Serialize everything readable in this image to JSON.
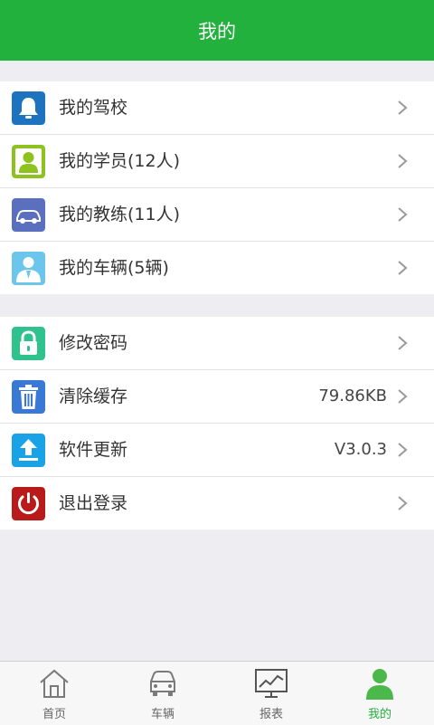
{
  "header": {
    "title": "我的"
  },
  "groups": [
    {
      "items": [
        {
          "label": "我的驾校",
          "value": "",
          "icon": "bell-icon",
          "color": "#1e73be"
        },
        {
          "label": "我的学员(12人)",
          "value": "",
          "icon": "student-icon",
          "color": "#8dc21f"
        },
        {
          "label": "我的教练(11人)",
          "value": "",
          "icon": "car-icon",
          "color": "#5a6fbd"
        },
        {
          "label": "我的车辆(5辆)",
          "value": "",
          "icon": "person-suit-icon",
          "color": "#6cc6ec"
        }
      ]
    },
    {
      "items": [
        {
          "label": "修改密码",
          "value": "",
          "icon": "lock-icon",
          "color": "#2fc28c"
        },
        {
          "label": "清除缓存",
          "value": "79.86KB",
          "icon": "trash-icon",
          "color": "#3a78d6"
        },
        {
          "label": "软件更新",
          "value": "V3.0.3",
          "icon": "upload-icon",
          "color": "#19a3e6"
        },
        {
          "label": "退出登录",
          "value": "",
          "icon": "power-icon",
          "color": "#b91a1a"
        }
      ]
    }
  ],
  "tabbar": {
    "active_color": "#22b13c",
    "tabs": [
      {
        "label": "首页",
        "icon": "home-icon"
      },
      {
        "label": "车辆",
        "icon": "car-front-icon"
      },
      {
        "label": "报表",
        "icon": "chart-icon"
      },
      {
        "label": "我的",
        "icon": "user-icon"
      }
    ]
  }
}
